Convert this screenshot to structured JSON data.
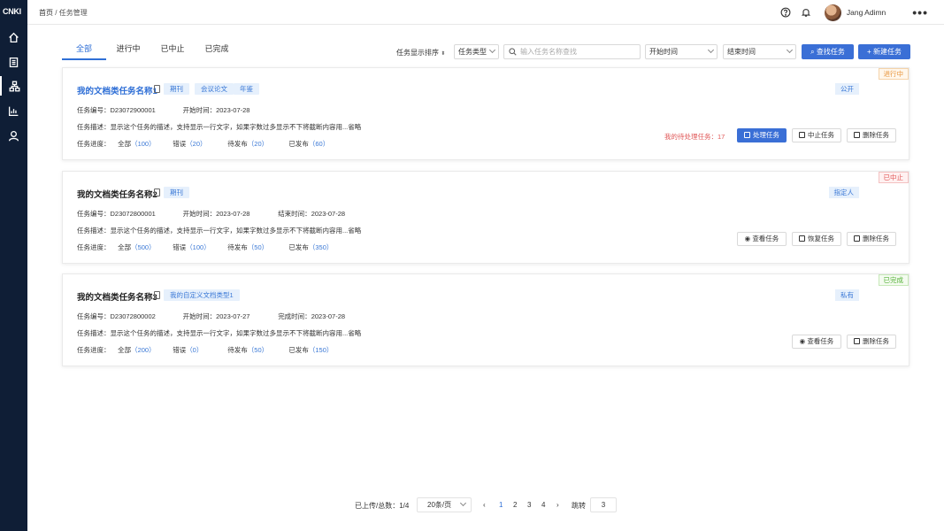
{
  "logo": "CNKI",
  "breadcrumb": {
    "home": "首页",
    "sep": "/",
    "current": "任务管理"
  },
  "user": {
    "name": "Jang Adimn"
  },
  "tabs": [
    "全部",
    "进行中",
    "已中止",
    "已完成"
  ],
  "filter": {
    "sort_label": "任务显示排序",
    "type_label": "任务类型",
    "search_placeholder": "输入任务名称查找",
    "start_label": "开始时间",
    "end_label": "结束时间",
    "search_button": "查找任务",
    "new_button": "新建任务"
  },
  "tasks": [
    {
      "title": "我的文档类任务名称1",
      "tags": [
        "期刊",
        "会议论文",
        "年鉴"
      ],
      "status": "进行中",
      "visibility": "公开",
      "code_label": "任务编号：",
      "code": "D23072900001",
      "start_label": "开始时间：",
      "start": "2023-07-28",
      "end_label": "",
      "end": "",
      "desc_label": "任务描述：",
      "desc": "显示这个任务的描述，支持显示一行文字，如果字数过多显示不下将截断内容用...省略",
      "progress_label": "任务进度：",
      "all_label": "全部",
      "all": "（100）",
      "err_label": "错误",
      "err": "（20）",
      "wait_label": "待发布",
      "wait": "（20）",
      "pub_label": "已发布",
      "pub": "（60）",
      "pending": "我的待处理任务：17",
      "actions": [
        "处理任务",
        "中止任务",
        "删除任务"
      ]
    },
    {
      "title": "我的文档类任务名称2",
      "tags": [
        "期刊"
      ],
      "status": "已中止",
      "visibility": "指定人",
      "code_label": "任务编号：",
      "code": "D23072800001",
      "start_label": "开始时间：",
      "start": "2023-07-28",
      "end_label": "结束时间：",
      "end": "2023-07-28",
      "desc_label": "任务描述：",
      "desc": "显示这个任务的描述，支持显示一行文字，如果字数过多显示不下将截断内容用...省略",
      "progress_label": "任务进度：",
      "all_label": "全部",
      "all": "（500）",
      "err_label": "错误",
      "err": "（100）",
      "wait_label": "待发布",
      "wait": "（50）",
      "pub_label": "已发布",
      "pub": "（350）",
      "actions": [
        "查看任务",
        "恢复任务",
        "删除任务"
      ]
    },
    {
      "title": "我的文档类任务名称3",
      "tags": [
        "我的自定义文档类型1"
      ],
      "status": "已完成",
      "visibility": "私有",
      "code_label": "任务编号：",
      "code": "D23072800002",
      "start_label": "开始时间：",
      "start": "2023-07-27",
      "end_label": "完成时间：",
      "end": "2023-07-28",
      "desc_label": "任务描述：",
      "desc": "显示这个任务的描述，支持显示一行文字，如果字数过多显示不下将截断内容用...省略",
      "progress_label": "任务进度：",
      "all_label": "全部",
      "all": "（200）",
      "err_label": "错误",
      "err": "（0）",
      "wait_label": "待发布",
      "wait": "（50）",
      "pub_label": "已发布",
      "pub": "（150）",
      "actions": [
        "查看任务",
        "删除任务"
      ]
    }
  ],
  "pager": {
    "summary": "已上传/总数：1/4",
    "page_size": "20条/页",
    "pages": [
      "1",
      "2",
      "3",
      "4"
    ],
    "jump_label": "跳转",
    "jump_value": "3"
  }
}
